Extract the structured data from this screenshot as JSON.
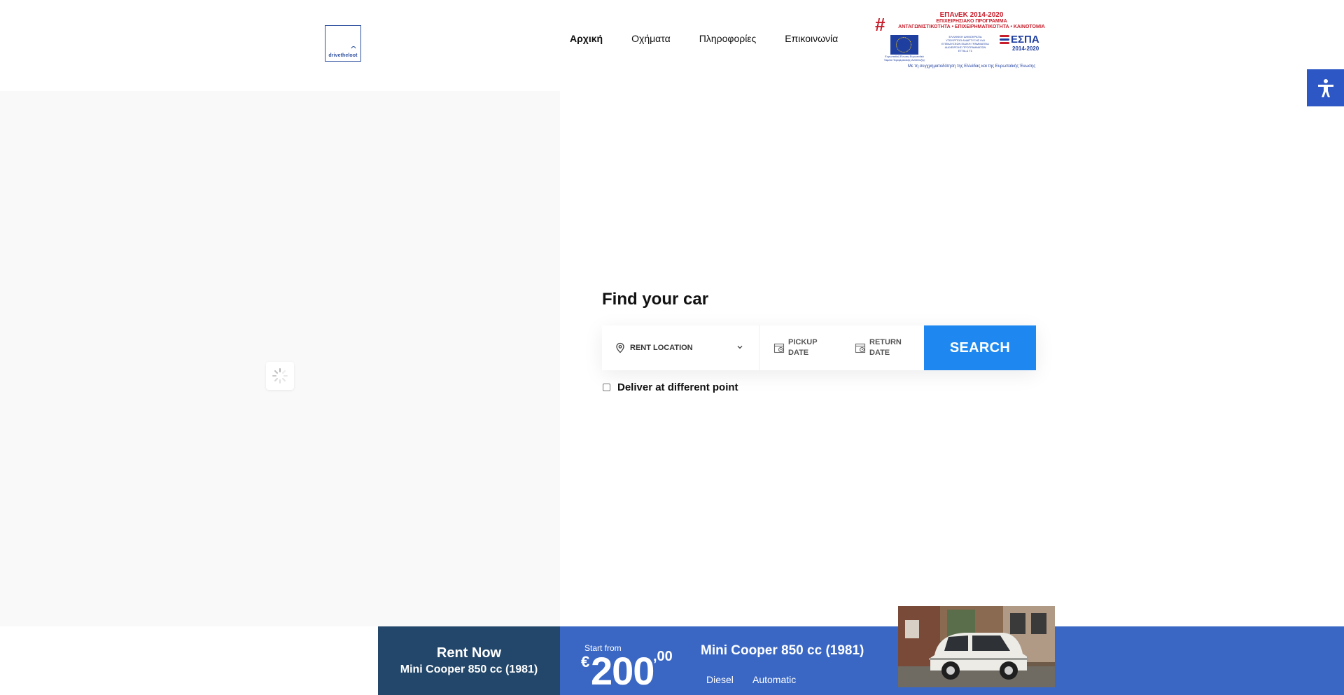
{
  "header": {
    "logo_text": "drivetheloot",
    "nav": [
      {
        "label": "Αρχική",
        "active": true
      },
      {
        "label": "Οχήματα",
        "active": false
      },
      {
        "label": "Πληροφορίες",
        "active": false
      },
      {
        "label": "Επικοινωνία",
        "active": false
      }
    ],
    "espa_banner": {
      "title": "ΕΠΑνΕΚ 2014-2020",
      "subtitle1": "ΕΠΙΧΕΙΡΗΣΙΑΚΟ ΠΡΟΓΡΑΜΜΑ",
      "subtitle2": "ΑΝΤΑΓΩΝΙΣΤΙΚΟΤΗΤΑ • ΕΠΙΧΕΙΡΗΜΑΤΙΚΟΤΗΤΑ • ΚΑΙΝΟΤΟΜΙΑ",
      "eu_text": "Ευρωπαϊκή Ένωση Ευρωπαϊκό Ταμείο Περιφερειακής Ανάπτυξης",
      "center_text": "ΕΛΛΗΝΙΚΗ ΔΗΜΟΚΡΑΤΙΑ ΥΠΟΥΡΓΕΙΟ ΑΝΑΠΤΥΞΗΣ ΚΑΙ ΕΠΕΝΔΥΣΕΩΝ ΕΙΔΙΚΗ ΓΡΑΜΜΑΤΕΙΑ ΔΙΑΧΕΙΡΙΣΗΣ ΠΡΟΓΡΑΜΜΑΤΩΝ ΕΤΠΑ & ΤΣ",
      "espa_word": "ΕΣΠΑ",
      "espa_years": "2014-2020",
      "bottom": "Με τη συγχρηματοδότηση της Ελλάδας και της Ευρωπαϊκής Ένωσης"
    }
  },
  "accessibility": {
    "icon": "accessibility-icon"
  },
  "finder": {
    "title": "Find your car",
    "location_label": "RENT LOCATION",
    "pickup_label": "PICKUP DATE",
    "return_label": "RETURN DATE",
    "search_label": "SEARCH",
    "deliver_label": "Deliver at different point",
    "deliver_checked": false
  },
  "rent_bar": {
    "rent_now": "Rent Now",
    "car_short": "Mini Cooper 850 cc (1981)",
    "start_from": "Start from",
    "currency": "€",
    "price_int": "200",
    "price_dec": ",00",
    "car_name": "Mini Cooper 850 cc (1981)",
    "fuel": "Diesel",
    "transmission": "Automatic"
  },
  "colors": {
    "accent": "#1e88f0",
    "rent_now_bg": "#23476a",
    "rent_info_bg": "#3a67c4",
    "a11y_bg": "#2d57c4"
  }
}
